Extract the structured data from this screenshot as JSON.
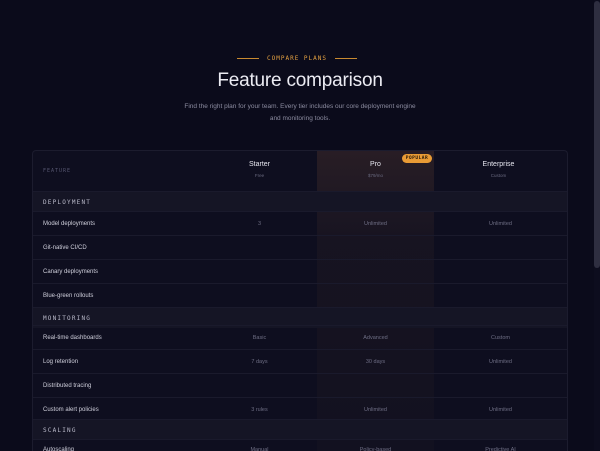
{
  "header": {
    "eyebrow": "COMPARE PLANS",
    "title": "Feature comparison",
    "subtitle_line1": "Find the right plan for your team. Every tier includes our core deployment engine",
    "subtitle_line2": "and monitoring tools."
  },
  "table": {
    "feature_header": "FEATURE",
    "plans": [
      {
        "name": "Starter",
        "price": "Free"
      },
      {
        "name": "Pro",
        "price": "$79/mo",
        "badge": "POPULAR"
      },
      {
        "name": "Enterprise",
        "price": "Custom"
      }
    ],
    "sections": [
      {
        "title": "DEPLOYMENT",
        "rows": [
          {
            "feature": "Model deployments",
            "values": [
              "3",
              "Unlimited",
              "Unlimited"
            ]
          },
          {
            "feature": "Git-native CI/CD",
            "values": [
              "",
              "",
              ""
            ]
          },
          {
            "feature": "Canary deployments",
            "values": [
              "",
              "",
              ""
            ]
          },
          {
            "feature": "Blue-green rollouts",
            "values": [
              "",
              "",
              ""
            ]
          }
        ]
      },
      {
        "title": "MONITORING",
        "rows": [
          {
            "feature": "Real-time dashboards",
            "values": [
              "Basic",
              "Advanced",
              "Custom"
            ]
          },
          {
            "feature": "Log retention",
            "values": [
              "7 days",
              "30 days",
              "Unlimited"
            ]
          },
          {
            "feature": "Distributed tracing",
            "values": [
              "",
              "",
              ""
            ]
          },
          {
            "feature": "Custom alert policies",
            "values": [
              "3 rules",
              "Unlimited",
              "Unlimited"
            ]
          }
        ]
      },
      {
        "title": "SCALING",
        "rows": [
          {
            "feature": "Autoscaling",
            "values": [
              "Manual",
              "Policy-based",
              "Predictive AI"
            ]
          }
        ]
      }
    ]
  },
  "colors": {
    "background": "#0b0b1b",
    "accent": "#e89b35",
    "table_bg": "#0e0e1f",
    "section_bg": "#151525"
  }
}
